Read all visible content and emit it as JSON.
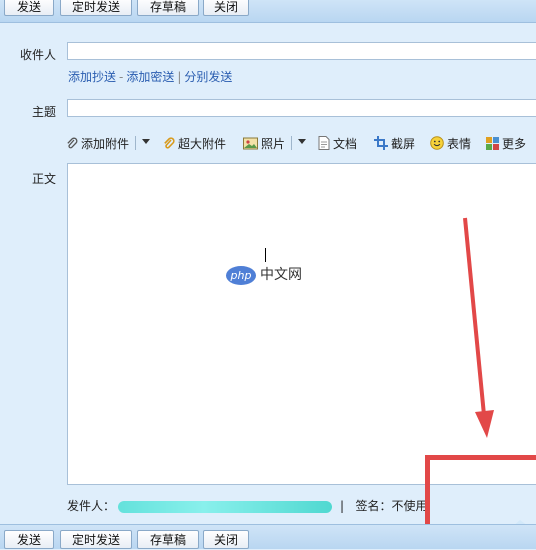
{
  "toolbar": {
    "send": "发送",
    "scheduled_send": "定时发送",
    "save_draft": "存草稿",
    "close": "关闭"
  },
  "compose": {
    "to_label": "收件人",
    "add_cc": "添加抄送",
    "link_sep": "-",
    "add_bcc": "添加密送",
    "pipe": "|",
    "separate_send": "分别发送",
    "subject_label": "主题",
    "body_label": "正文"
  },
  "attachments": {
    "add_attachment": "添加附件",
    "large_attachment": "超大附件",
    "photo": "照片",
    "document": "文档",
    "screenshot": "截屏",
    "emoji": "表情",
    "more": "更多"
  },
  "watermark": {
    "badge": "php",
    "text": "中文网"
  },
  "footer": {
    "sender_label": "发件人：",
    "pipe": "|",
    "signature": "签名：不使用"
  },
  "colors": {
    "annotation_red": "#e24848",
    "link_blue": "#2a5db0",
    "redaction": "#56e0d8"
  }
}
